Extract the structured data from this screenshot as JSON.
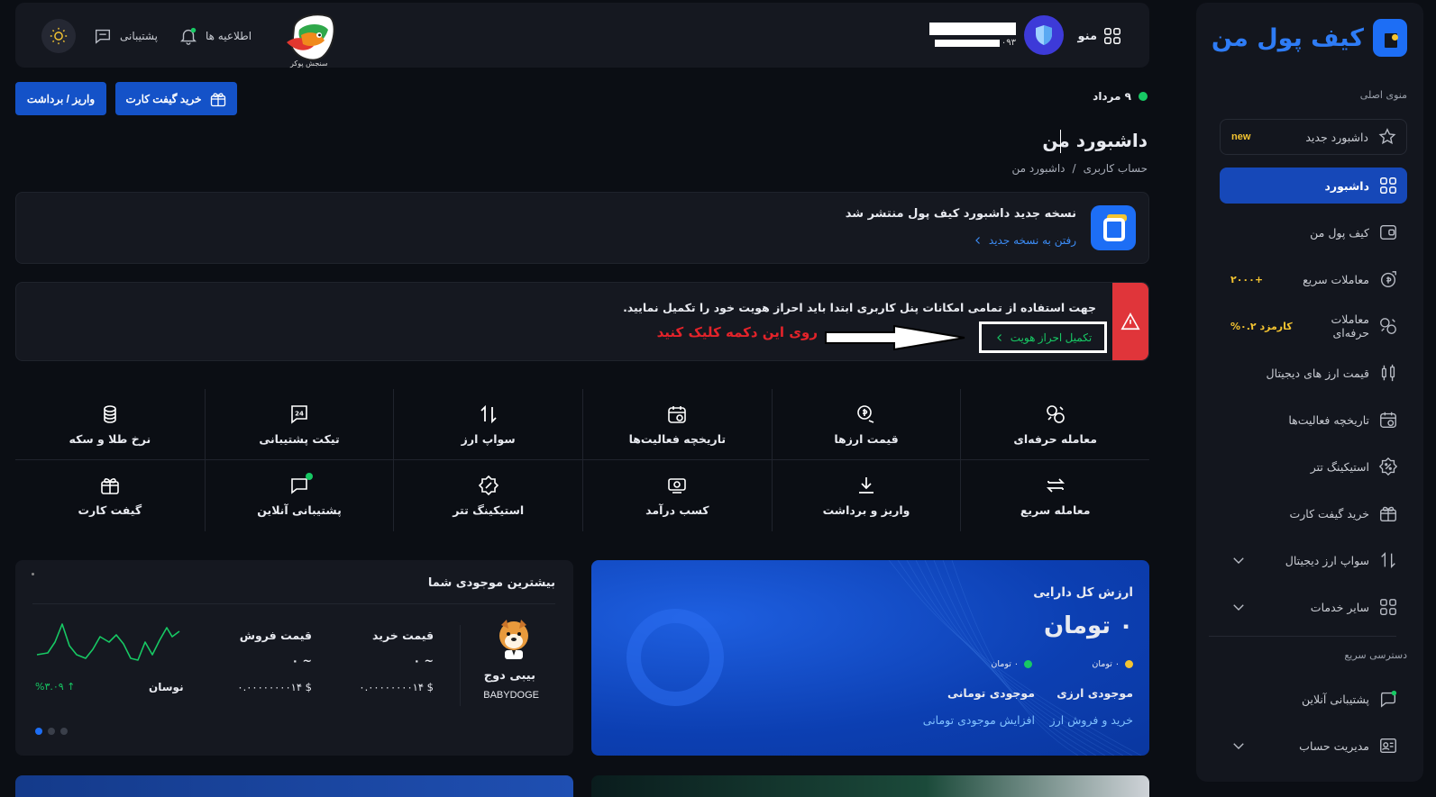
{
  "sidebar": {
    "brand": "کیف پول من",
    "main_menu_label": "منوی اصلی",
    "items": [
      {
        "label": "داشبورد جدید",
        "extra": "new",
        "extra_color": "#f4c431",
        "icon": "sparkle-star-icon"
      },
      {
        "label": "داشبورد",
        "extra": "",
        "icon": "grid-icon",
        "active": true
      },
      {
        "label": "کیف پول من",
        "extra": "",
        "icon": "wallet-icon"
      },
      {
        "label": "معاملات سریع",
        "extra": "+۲۰۰۰",
        "extra_color": "#f4c431",
        "icon": "fast-exchange-icon"
      },
      {
        "label": "معاملات حرفه‌ای",
        "extra": "کارمزد ۰.۲%",
        "extra_color": "#f4c431",
        "icon": "pro-trade-icon"
      },
      {
        "label": "قیمت ارز های دیجیتال",
        "extra": "",
        "icon": "candles-icon"
      },
      {
        "label": "تاریخچه فعالیت‌ها",
        "extra": "",
        "icon": "history-calendar-icon"
      },
      {
        "label": "استیکینگ تتر",
        "extra": "",
        "icon": "staking-icon"
      },
      {
        "label": "خرید گیفت کارت",
        "extra": "",
        "icon": "gift-icon"
      },
      {
        "label": "سواپ ارز دیجیتال",
        "extra": "",
        "icon": "swap-icon",
        "expandable": true
      },
      {
        "label": "سایر خدمات",
        "extra": "",
        "icon": "grid-icon",
        "expandable": true
      }
    ],
    "quick_access_label": "دسترسی سریع",
    "quick_items": [
      {
        "label": "پشتیبانی آنلاین",
        "icon": "chat-support-icon"
      },
      {
        "label": "مدیریت حساب",
        "icon": "id-card-icon",
        "expandable": true
      }
    ]
  },
  "header": {
    "menu_label": "منو",
    "phone_prefix": "۰۹۳",
    "mascot_caption": "سنجش پوکر",
    "notifications_label": "اطلاعیه ها",
    "support_label": "پشتیبانی"
  },
  "toolbar": {
    "date": "۹ مرداد",
    "buy_gift_card": "خرید گیفت کارت",
    "deposit_withdraw": "واریز / برداشت"
  },
  "page": {
    "title": "داشبورد من",
    "breadcrumb": [
      "حساب کاربری",
      "/",
      "داشبورد من"
    ]
  },
  "new_version": {
    "title": "نسخه جدید داشبورد کیف پول منتشر شد",
    "link": "رفتن به نسخه جدید"
  },
  "kyc_alert": {
    "message": "جهت استفاده از تمامی امکانات پنل کاربری ابتدا باید احراز هویت خود را تکمیل نمایید.",
    "button": "تکمیل احراز هویت",
    "annotation": "روی این دکمه کلیک کنید"
  },
  "quick_actions": [
    {
      "label": "معامله حرفه‌ای",
      "icon": "pro-trade-icon"
    },
    {
      "label": "قیمت ارزها",
      "icon": "coin-price-icon"
    },
    {
      "label": "تاریخچه فعالیت‌ها",
      "icon": "history-calendar-icon"
    },
    {
      "label": "سواپ ارز",
      "icon": "swap-icon"
    },
    {
      "label": "تیکت پشتیبانی",
      "icon": "ticket-24-icon"
    },
    {
      "label": "نرخ طلا و سکه",
      "icon": "gold-coins-icon"
    },
    {
      "label": "معامله سریع",
      "icon": "fast-exchange-icon"
    },
    {
      "label": "واریز و برداشت",
      "icon": "download-icon"
    },
    {
      "label": "کسب درآمد",
      "icon": "earn-icon"
    },
    {
      "label": "استیکینگ تتر",
      "icon": "staking-icon"
    },
    {
      "label": "پشتیبانی آنلاین",
      "icon": "chat-support-icon"
    },
    {
      "label": "گیفت کارت",
      "icon": "gift-icon"
    }
  ],
  "assets": {
    "title": "ارزش کل دارایی",
    "total": "۰ تومان",
    "crypto_mini": "۰ تومان",
    "crypto_dot_color": "#f4c431",
    "toman_mini": "۰ تومان",
    "toman_dot_color": "#17c964",
    "crypto_label": "موجودی ارزی",
    "toman_label": "موجودی تومانی",
    "crypto_link": "خرید و فروش ارز",
    "toman_link": "افزایش موجودی تومانی"
  },
  "holdings": {
    "title": "بیشترین موجودی شما",
    "coin_name": "بیبی دوج",
    "coin_symbol": "BABYDOGE",
    "buy_price_label": "قیمت خرید",
    "sell_price_label": "قیمت فروش",
    "buy_approx": "~ ۰",
    "sell_approx": "~ ۰",
    "buy_usd": "$ ۰.۰۰۰۰۰۰۰۰۱۴",
    "sell_usd": "$ ۰.۰۰۰۰۰۰۰۰۱۴",
    "volatility_label": "نوسان",
    "volatility_value": "↑ %۳.۰۹"
  }
}
